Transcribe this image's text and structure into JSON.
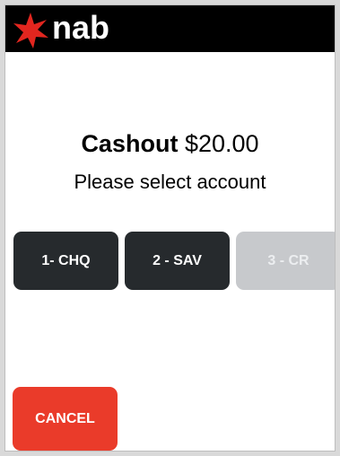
{
  "brand": {
    "name": "nab",
    "logo_icon": "nab-star-icon",
    "accent_color": "#e2261f",
    "header_color": "#000000"
  },
  "transaction": {
    "type_label": "Cashout",
    "amount": "$20.00",
    "prompt": "Please select account"
  },
  "accounts": [
    {
      "label": "1- CHQ",
      "enabled": true
    },
    {
      "label": "2 - SAV",
      "enabled": true
    },
    {
      "label": "3 - CR",
      "enabled": false
    }
  ],
  "actions": {
    "cancel_label": "CANCEL",
    "cancel_color": "#ea3b2a"
  }
}
